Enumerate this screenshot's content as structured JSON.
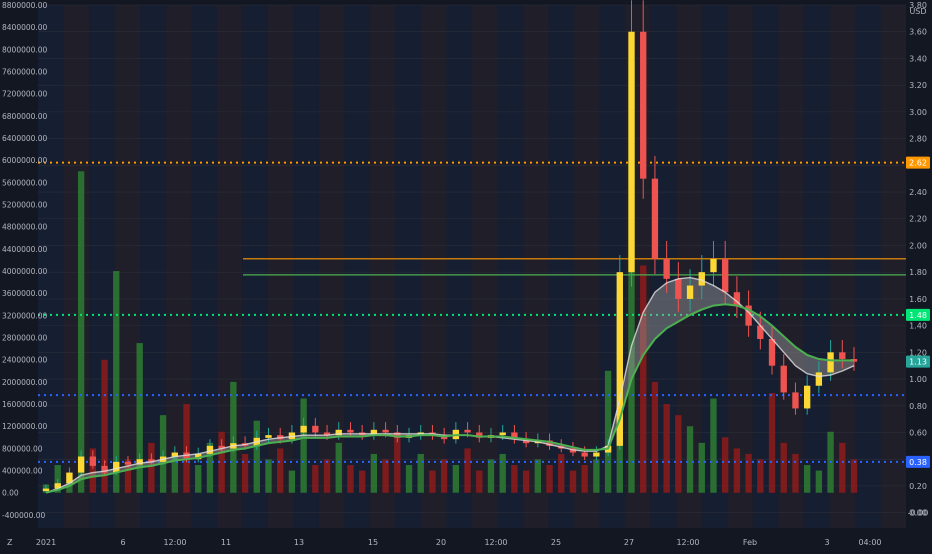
{
  "currency": "USD",
  "timezone_icon": "Z",
  "colors": {
    "background": "#131722",
    "up": "#26a69a",
    "down": "#b71c1c",
    "sma": "#e0e0e0",
    "ema": "#4caf50",
    "orange_level": "#ff9800",
    "green_level": "#00e676",
    "blue_level": "#2962ff"
  },
  "chart_data": {
    "type": "candlestick",
    "price_axis": {
      "ylim": [
        -0.1,
        3.8
      ],
      "ticks": [
        "3.80",
        "3.60",
        "3.40",
        "3.20",
        "3.00",
        "2.80",
        "2.60",
        "2.40",
        "2.20",
        "2.00",
        "1.80",
        "1.60",
        "1.40",
        "1.20",
        "1.00",
        "0.80",
        "0.60",
        "0.40",
        "0.20",
        "0.00",
        "-0.00"
      ]
    },
    "volume_axis": {
      "ylim": [
        -600000,
        8800000
      ],
      "ticks": [
        "8800000.00",
        "8400000.00",
        "8000000.00",
        "7600000.00",
        "7200000.00",
        "6800000.00",
        "6400000.00",
        "6000000.00",
        "5600000.00",
        "5200000.00",
        "4800000.00",
        "4400000.00",
        "4000000.00",
        "3600000.00",
        "3200000.00",
        "2800000.00",
        "2400000.00",
        "2000000.00",
        "1600000.00",
        "1200000.00",
        "800000.00",
        "400000.00",
        "0.00",
        "-400000.00"
      ]
    },
    "time_labels": [
      "2021",
      "6",
      "12:00",
      "11",
      "13",
      "15",
      "20",
      "12:00",
      "25",
      "27",
      "12:00",
      "Feb",
      "3",
      "04:00"
    ],
    "price_badges": [
      {
        "label": "2.62",
        "value": 2.62,
        "color": "#ff9800"
      },
      {
        "label": "1.48",
        "value": 1.48,
        "color": "#00e676"
      },
      {
        "label": "1.13",
        "value": 1.13,
        "color": "#26a69a"
      },
      {
        "label": "0.38",
        "value": 0.38,
        "color": "#2962ff"
      }
    ],
    "horizontal_levels": [
      {
        "value": 2.62,
        "style": "dotted",
        "color": "#ff9800"
      },
      {
        "value": 1.48,
        "style": "dotted",
        "color": "#00e676"
      },
      {
        "value": 0.38,
        "style": "dotted",
        "color": "#2962ff"
      },
      {
        "value": 0.88,
        "style": "dotted",
        "color": "#2962ff"
      },
      {
        "value": 1.9,
        "style": "solid",
        "color": "#ff9800"
      },
      {
        "value": 1.78,
        "style": "solid",
        "color": "#4caf50"
      }
    ],
    "close_series": [
      0.18,
      0.22,
      0.3,
      0.42,
      0.35,
      0.3,
      0.38,
      0.36,
      0.4,
      0.38,
      0.42,
      0.45,
      0.4,
      0.44,
      0.5,
      0.48,
      0.52,
      0.5,
      0.56,
      0.58,
      0.55,
      0.6,
      0.65,
      0.6,
      0.58,
      0.62,
      0.6,
      0.58,
      0.62,
      0.6,
      0.56,
      0.58,
      0.6,
      0.58,
      0.55,
      0.62,
      0.6,
      0.56,
      0.58,
      0.6,
      0.55,
      0.52,
      0.54,
      0.5,
      0.48,
      0.45,
      0.42,
      0.45,
      0.5,
      1.8,
      3.6,
      2.5,
      1.9,
      1.75,
      1.6,
      1.7,
      1.8,
      1.9,
      1.65,
      1.55,
      1.4,
      1.3,
      1.1,
      0.9,
      0.78,
      0.95,
      1.05,
      1.2,
      1.15,
      1.13
    ],
    "sma_series": [
      0.15,
      0.18,
      0.22,
      0.28,
      0.3,
      0.31,
      0.33,
      0.35,
      0.37,
      0.38,
      0.4,
      0.42,
      0.43,
      0.44,
      0.46,
      0.48,
      0.5,
      0.51,
      0.53,
      0.55,
      0.56,
      0.57,
      0.58,
      0.58,
      0.58,
      0.59,
      0.59,
      0.59,
      0.59,
      0.59,
      0.59,
      0.59,
      0.59,
      0.59,
      0.58,
      0.58,
      0.58,
      0.57,
      0.57,
      0.56,
      0.55,
      0.54,
      0.53,
      0.51,
      0.49,
      0.47,
      0.46,
      0.46,
      0.5,
      0.85,
      1.25,
      1.5,
      1.65,
      1.72,
      1.75,
      1.76,
      1.74,
      1.7,
      1.65,
      1.58,
      1.5,
      1.4,
      1.3,
      1.2,
      1.1,
      1.04,
      1.02,
      1.03,
      1.06,
      1.1
    ],
    "ema_series": [
      0.15,
      0.17,
      0.2,
      0.25,
      0.27,
      0.28,
      0.3,
      0.32,
      0.34,
      0.35,
      0.37,
      0.39,
      0.4,
      0.41,
      0.43,
      0.45,
      0.47,
      0.48,
      0.5,
      0.52,
      0.53,
      0.54,
      0.56,
      0.56,
      0.56,
      0.57,
      0.57,
      0.57,
      0.58,
      0.58,
      0.57,
      0.57,
      0.58,
      0.58,
      0.57,
      0.58,
      0.58,
      0.57,
      0.57,
      0.57,
      0.56,
      0.55,
      0.54,
      0.53,
      0.51,
      0.49,
      0.47,
      0.47,
      0.48,
      0.7,
      1.0,
      1.18,
      1.3,
      1.38,
      1.43,
      1.48,
      1.52,
      1.55,
      1.56,
      1.55,
      1.52,
      1.47,
      1.4,
      1.32,
      1.24,
      1.18,
      1.15,
      1.14,
      1.14,
      1.14
    ],
    "volume_series": [
      150000,
      500000,
      300000,
      5800000,
      800000,
      2400000,
      4000000,
      600000,
      2700000,
      900000,
      1400000,
      700000,
      1600000,
      500000,
      900000,
      1100000,
      2000000,
      700000,
      1300000,
      600000,
      800000,
      400000,
      1700000,
      500000,
      600000,
      900000,
      500000,
      400000,
      700000,
      600000,
      1000000,
      500000,
      700000,
      400000,
      600000,
      500000,
      800000,
      400000,
      600000,
      700000,
      500000,
      400000,
      600000,
      500000,
      700000,
      400000,
      500000,
      600000,
      2200000,
      3600000,
      7800000,
      4100000,
      2000000,
      1600000,
      1400000,
      1200000,
      900000,
      1700000,
      1000000,
      800000,
      700000,
      600000,
      1800000,
      900000,
      700000,
      500000,
      400000,
      1100000,
      900000,
      600000
    ]
  }
}
